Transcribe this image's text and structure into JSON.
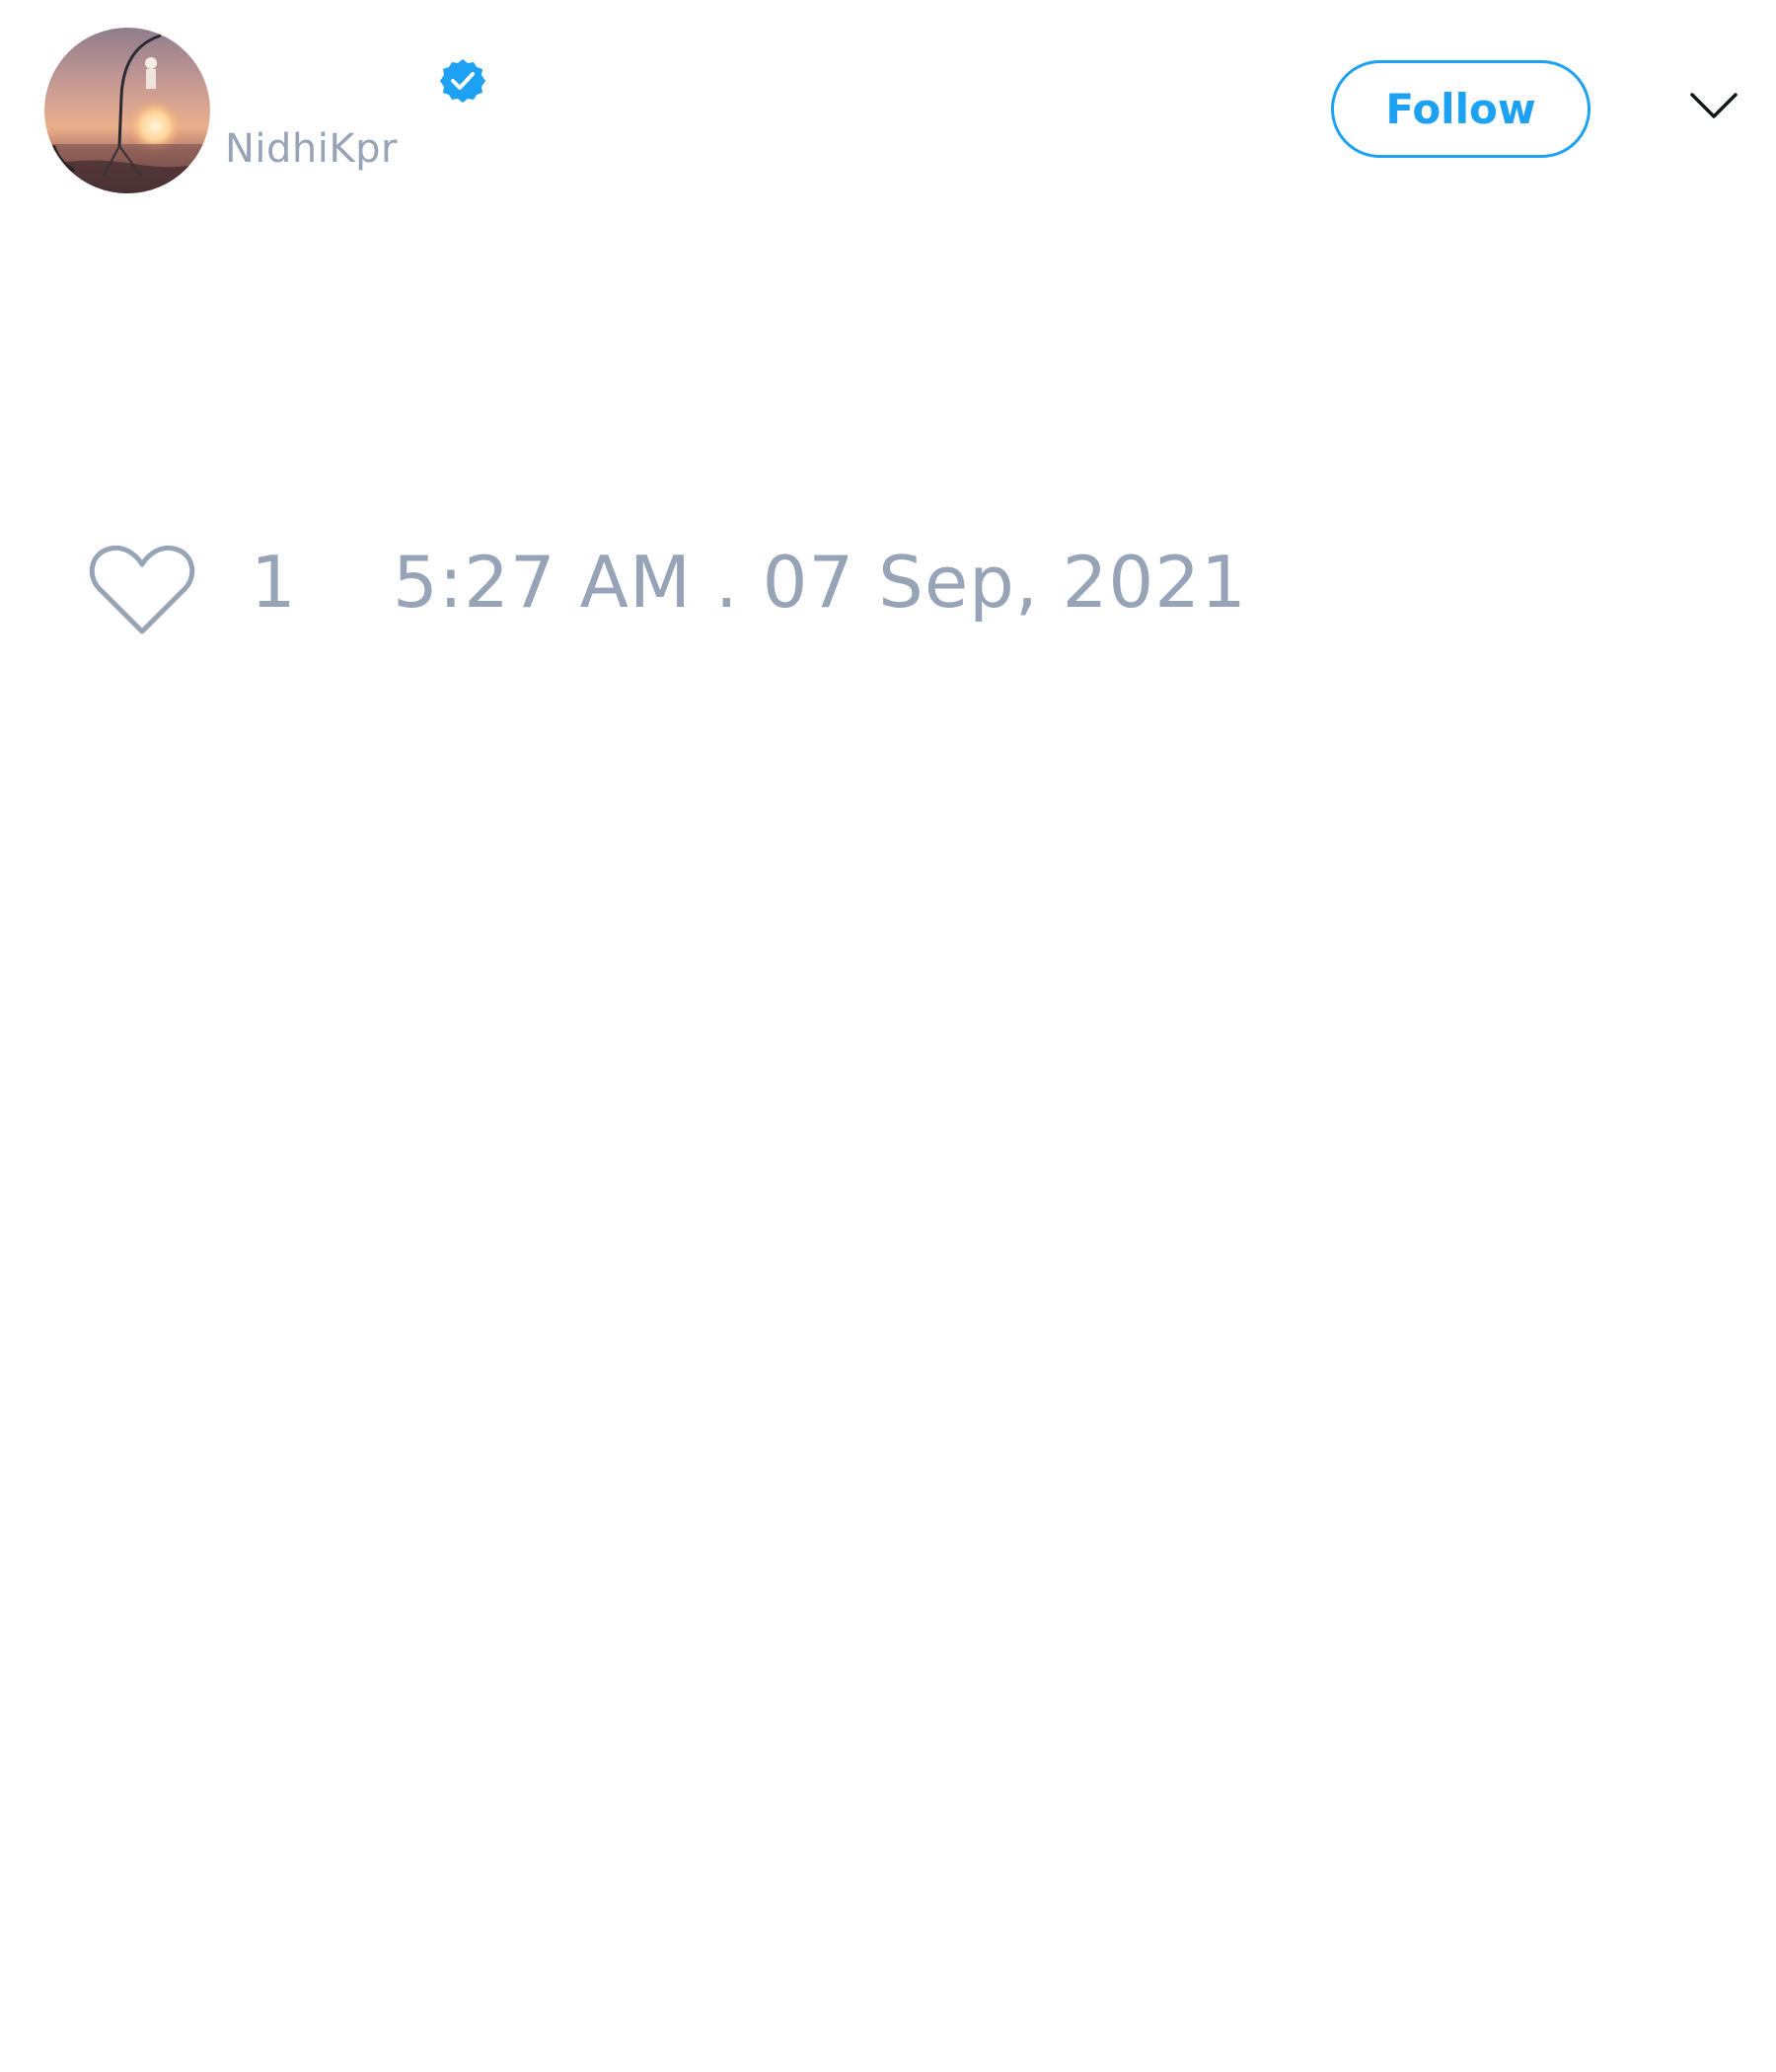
{
  "tweet": {
    "author": {
      "display_name": "",
      "handle": "NidhiKpr",
      "verified": true,
      "avatar_icon": "sunset-swing-avatar"
    },
    "follow_label": "Follow",
    "menu_icon": "chevron-down-icon",
    "like_icon": "heart-outline-icon",
    "like_count": "1",
    "timestamp": "5:27 AM . 07 Sep, 2021"
  },
  "colors": {
    "accent": "#1da1f2",
    "muted_text": "#97a3b6",
    "background": "#ffffff"
  }
}
